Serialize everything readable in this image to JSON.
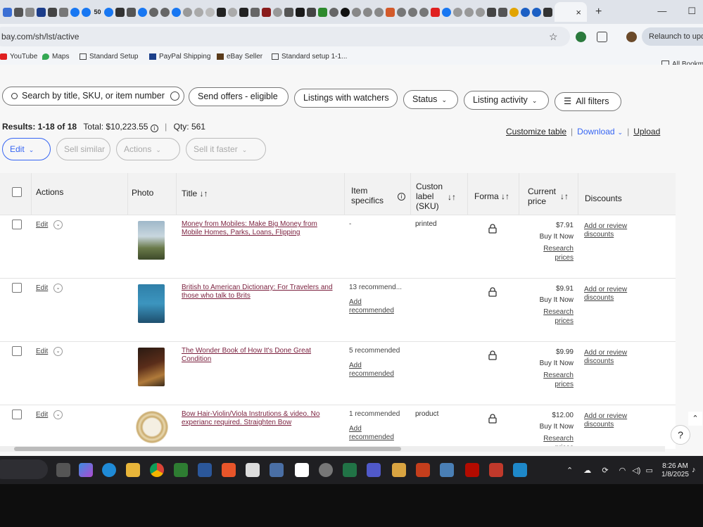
{
  "browser": {
    "url": "bay.com/sh/lst/active",
    "relaunch_label": "Relaunch to updat",
    "tab_close": "×",
    "new_tab": "+",
    "minimize": "—",
    "restore": "☐",
    "tab_icon_text": "50",
    "bookmarks": [
      "YouTube",
      "Maps",
      "Standard Setup",
      "PayPal Shipping",
      "eBay Seller",
      "Standard setup 1-1..."
    ],
    "all_bookmarks": "All Bookm"
  },
  "filters": {
    "search_placeholder": "Search by title, SKU, or item number",
    "send_offers": "Send offers - eligible",
    "listings_with_watchers": "Listings with watchers",
    "status": "Status",
    "listing_activity": "Listing activity",
    "all_filters": "All filters"
  },
  "summary": {
    "results": "Results: 1-18 of 18",
    "total": "Total: $10,223.55",
    "qty": "Qty: 561",
    "customize_table": "Customize table",
    "download": "Download",
    "upload": "Upload"
  },
  "bulk_actions": {
    "edit": "Edit",
    "sell_similar": "Sell similar",
    "actions": "Actions",
    "sell_it_faster": "Sell it faster"
  },
  "table": {
    "headers": {
      "actions": "Actions",
      "photo": "Photo",
      "title": "Title ↓↑",
      "item_specifics_1": "Item",
      "item_specifics_2": "specifics",
      "custom_label_1": "Custon",
      "custom_label_2": "label",
      "custom_label_3": "(SKU)",
      "sort": "↓↑",
      "format": "Forma ↓↑",
      "current_price_1": "Current",
      "current_price_2": "price",
      "discounts": "Discounts"
    },
    "rows": [
      {
        "edit": "Edit",
        "title": "Money from Mobiles: Make Big Money from Mobile Homes, Parks, Loans, Flipping",
        "spec1": "-",
        "spec2": "",
        "sku": "printed",
        "price": "$7.91",
        "format": "Buy It Now",
        "research1": "Research",
        "research2": "prices",
        "discounts": "Add or review discounts"
      },
      {
        "edit": "Edit",
        "title": "British to American Dictionary: For Travelers and those who talk to Brits",
        "spec1": "13 recommend...",
        "spec2": "Add recommended",
        "sku": "",
        "price": "$9.91",
        "format": "Buy It Now",
        "research1": "Research",
        "research2": "prices",
        "discounts": "Add or review discounts"
      },
      {
        "edit": "Edit",
        "title": "The Wonder Book of How It's Done Great Condition",
        "spec1": "5 recommended",
        "spec2": "Add recommended",
        "sku": "",
        "price": "$9.99",
        "format": "Buy It Now",
        "research1": "Research",
        "research2": "prices",
        "discounts": "Add or review discounts"
      },
      {
        "edit": "Edit",
        "title": "Bow Hair-Violin/Viola Instrutions & video. No experianc required. Straighten Bow",
        "spec1": "1 recommended",
        "spec2": "Add recommended",
        "sku": "product",
        "price": "$12.00",
        "format": "Buy It Now",
        "research1": "Research",
        "research2": "prices",
        "discounts": "Add or review discounts"
      }
    ]
  },
  "help": "?",
  "taskbar": {
    "time": "8:26 AM",
    "date": "1/8/2025"
  }
}
